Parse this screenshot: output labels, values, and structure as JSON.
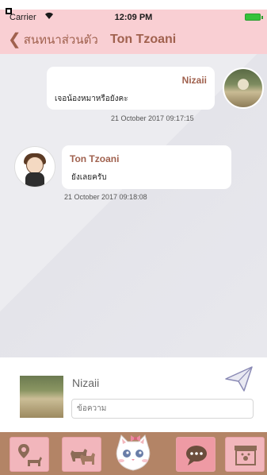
{
  "status_bar": {
    "carrier": "Carrier",
    "time": "12:09 PM",
    "battery_color": "#35c23b"
  },
  "nav": {
    "back_label": "สนทนาส่วนตัว",
    "title": "Ton Tzoani",
    "background": "#f9cfd3",
    "text_color": "#a0614e"
  },
  "messages": [
    {
      "sender": "Nizaii",
      "text": "เจอน้องหมาหรือยังคะ",
      "timestamp": "21 October 2017 09:17:15",
      "side": "right"
    },
    {
      "sender": "Ton Tzoani",
      "text": "ยังเลยครับ",
      "timestamp": "21 October 2017 09:18:08",
      "side": "left"
    }
  ],
  "compose": {
    "user_name": "Nizaii",
    "placeholder": "ข้อความ",
    "send_icon": "paper-plane-icon"
  },
  "tab_bar": {
    "background": "#b38466",
    "tabs": [
      {
        "icon": "map-pin-dog-icon"
      },
      {
        "icon": "dogs-icon"
      },
      {
        "icon": "cat-face-icon"
      },
      {
        "icon": "chat-bubble-icon"
      },
      {
        "icon": "pet-shop-icon"
      }
    ]
  }
}
